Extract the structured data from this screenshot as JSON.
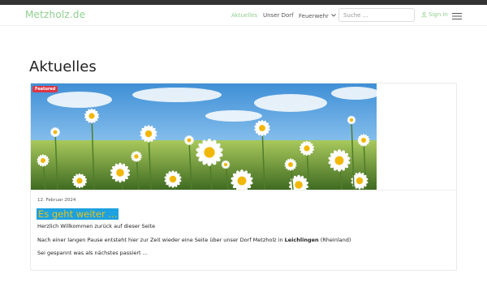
{
  "brand": {
    "name": "Metzholz.de",
    "color": "#8fcf8f"
  },
  "nav": {
    "items": [
      {
        "label": "Aktuelles",
        "active": true
      },
      {
        "label": "Unser Dorf",
        "active": false
      },
      {
        "label": "Feuerwehr",
        "active": false,
        "has_dropdown": true
      }
    ],
    "search_placeholder": "Suche ...",
    "signin_label": "Sign In",
    "signin_icon": "user-icon",
    "menu_icon": "hamburger-menu-icon"
  },
  "page": {
    "title": "Aktuelles"
  },
  "post": {
    "badge": "Featured",
    "badge_color": "#dc3545",
    "image": "daisy-field-photo",
    "date": "12. Februar 2024",
    "title": "Es geht weiter ...",
    "p1": "Herzlich Willkommen zurück auf dieser Seite",
    "p2_before": "Nach einer langen Pause entsteht hier zur Zeit wieder eine Seite über unser Dorf Metzholz in ",
    "p2_bold": "Leichlingen",
    "p2_after": " (Rheinland)",
    "p3": "Sei gespannt was als nächstes passiert ..."
  }
}
